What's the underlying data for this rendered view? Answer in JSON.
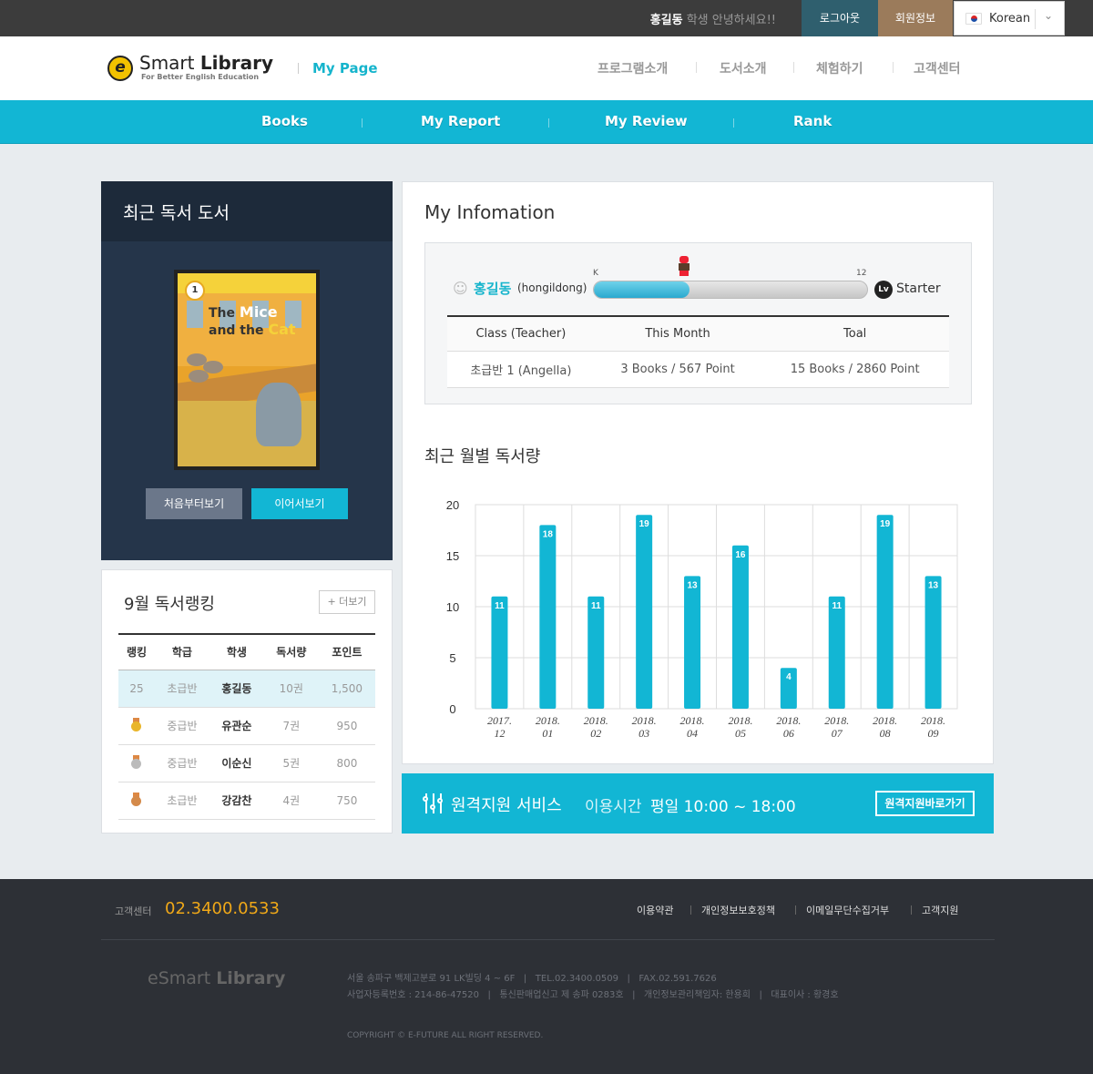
{
  "topbar": {
    "user_name": "홍길동",
    "greeting": " 학생 안녕하세요!!",
    "logout": "로그아웃",
    "member_info": "회원정보",
    "language": "Korean"
  },
  "header": {
    "logo_letter": "e",
    "logo_text_1": "Smart ",
    "logo_text_2": "Library",
    "logo_sub": "For Better English Education",
    "mypage": "My Page",
    "nav": [
      "프로그램소개",
      "도서소개",
      "체험하기",
      "고객센터"
    ]
  },
  "subnav": [
    "Books",
    "My Report",
    "My Review",
    "Rank"
  ],
  "recent": {
    "title": "최근 독서 도서",
    "book_title_1": "The ",
    "book_title_2": "Mice",
    "book_title_3": "and the ",
    "book_title_4": "Cat",
    "book_level": "1",
    "btn_first": "처음부터보기",
    "btn_continue": "이어서보기"
  },
  "ranking": {
    "title": "9월 독서랭킹",
    "more": "+ 더보기",
    "headers": [
      "랭킹",
      "학급",
      "학생",
      "독서량",
      "포인트"
    ],
    "rows": [
      {
        "rank": "25",
        "class": "초급반",
        "name": "홍길동",
        "books": "10권",
        "points": "1,500",
        "medal": ""
      },
      {
        "rank": "",
        "class": "중급반",
        "name": "유관순",
        "books": "7권",
        "points": "950",
        "medal": "gold"
      },
      {
        "rank": "",
        "class": "중급반",
        "name": "이순신",
        "books": "5권",
        "points": "800",
        "medal": "silver"
      },
      {
        "rank": "",
        "class": "초급반",
        "name": "강감찬",
        "books": "4권",
        "points": "750",
        "medal": "bronze"
      }
    ]
  },
  "info": {
    "title": "My Infomation",
    "user_name": "홍길동",
    "user_id": "(hongildong)",
    "level_min": "K",
    "level_max": "12",
    "progress": 0.35,
    "lv_badge": "Lv",
    "level_name": "Starter",
    "table_headers": [
      "Class (Teacher)",
      "This Month",
      "Toal"
    ],
    "table_values": [
      "초급반 1 (Angella)",
      "3 Books / 567 Point",
      "15 Books / 2860 Point"
    ]
  },
  "chart_title": "최근 월별 독서량",
  "chart_data": {
    "type": "bar",
    "categories": [
      "2017.12",
      "2018.01",
      "2018.02",
      "2018.03",
      "2018.04",
      "2018.05",
      "2018.06",
      "2018.07",
      "2018.08",
      "2018.09"
    ],
    "category_lines": [
      [
        "2017.",
        "12"
      ],
      [
        "2018.",
        "01"
      ],
      [
        "2018.",
        "02"
      ],
      [
        "2018.",
        "03"
      ],
      [
        "2018.",
        "04"
      ],
      [
        "2018.",
        "05"
      ],
      [
        "2018.",
        "06"
      ],
      [
        "2018.",
        "07"
      ],
      [
        "2018.",
        "08"
      ],
      [
        "2018.",
        "09"
      ]
    ],
    "values": [
      11,
      18,
      11,
      19,
      13,
      16,
      4,
      11,
      19,
      13
    ],
    "ylim": [
      0,
      20
    ],
    "yticks": [
      0,
      5,
      10,
      15,
      20
    ],
    "grid": true,
    "color": "#12b6d4"
  },
  "remote": {
    "title": "원격지원 서비스",
    "time_label": "이용시간",
    "time": "평일 10:00 ~ 18:00",
    "button": "원격지원바로가기"
  },
  "footer": {
    "cs_label": "고객센터",
    "cs_number": "02.3400.0533",
    "links": [
      "이용약관",
      "개인정보보호정책",
      "이메일무단수집거부",
      "고객지원"
    ],
    "logo_1": "eSmart ",
    "logo_2": "Library",
    "address_line1": "서울 송파구 백제고분로 91 LK빌딩 4 ~ 6F   |   TEL.02.3400.0509   |   FAX.02.591.7626",
    "address_line2": "사업자등록번호 : 214-86-47520   |   통신판매업신고 제 송파 0283호   |   개인정보관리책임자: 한용희   |   대표이사 : 황경호",
    "copyright": "COPYRIGHT © E-FUTURE ALL RIGHT RESERVED."
  }
}
